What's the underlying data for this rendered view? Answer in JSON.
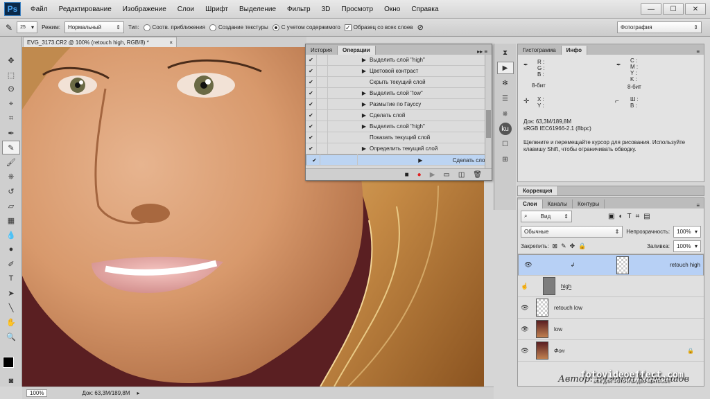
{
  "menubar": {
    "logo": "Ps",
    "items": [
      "Файл",
      "Редактирование",
      "Изображение",
      "Слои",
      "Шрифт",
      "Выделение",
      "Фильтр",
      "3D",
      "Просмотр",
      "Окно",
      "Справка"
    ],
    "win_controls": [
      "—",
      "☐",
      "✕"
    ]
  },
  "options": {
    "brush_size": "25",
    "mode_label": "Режим:",
    "mode_value": "Нормальный",
    "type_label": "Тип:",
    "opt1": "Соотв. приближения",
    "opt2": "Создание текстуры",
    "opt3": "С учетом содержимого",
    "sample_all": "Образец со всех слоев",
    "workspace": "Фотография"
  },
  "document": {
    "tab_title": "EVG_3173.CR2 @ 100% (retouch high, RGB/8) *",
    "close": "×"
  },
  "status": {
    "zoom": "100%",
    "doc_info": "Док: 63,3M/189,8M"
  },
  "actions_panel": {
    "tab_history": "История",
    "tab_actions": "Операции",
    "rows": [
      {
        "label": "Выделить слой \"high\"",
        "expand": true
      },
      {
        "label": "Цветовой контраст",
        "expand": true
      },
      {
        "label": "Скрыть текущий слой",
        "expand": false
      },
      {
        "label": "Выделить слой \"low\"",
        "expand": true
      },
      {
        "label": "Размытие по Гауссу",
        "expand": true
      },
      {
        "label": "Сделать слой",
        "expand": true
      },
      {
        "label": "Выделить слой \"high\"",
        "expand": true
      },
      {
        "label": "Показать текущий слой",
        "expand": false
      },
      {
        "label": "Определить текущий слой",
        "expand": true
      },
      {
        "label": "Сделать слой",
        "expand": true
      }
    ]
  },
  "info_panel": {
    "tab_hist": "Гистограмма",
    "tab_info": "Инфо",
    "rgb": [
      "R :",
      "G :",
      "B :"
    ],
    "cmyk": [
      "C :",
      "M :",
      "Y :",
      "K :"
    ],
    "bit1": "8-бит",
    "bit2": "8-бит",
    "xy": [
      "X :",
      "Y :"
    ],
    "wh": [
      "Ш :",
      "В :"
    ],
    "doc": "Док: 63,3M/189,8M",
    "profile": "sRGB IEC61966-2.1 (8bpc)",
    "hint": "Щелкните и перемещайте курсор для рисования. Используйте клавишу Shift, чтобы ограничивать обводку."
  },
  "correction_panel": {
    "title": "Коррекция"
  },
  "layers_panel": {
    "tab_layers": "Слои",
    "tab_channels": "Каналы",
    "tab_paths": "Контуры",
    "filter": "Вид",
    "blend": "Обычные",
    "opacity_label": "Непрозрачность:",
    "opacity": "100%",
    "lock_label": "Закрепить:",
    "fill_label": "Заливка:",
    "fill": "100%",
    "layers": [
      {
        "name": "retouch high",
        "selected": true,
        "thumb": "checker"
      },
      {
        "name": "high",
        "selected": false,
        "thumb": "gray"
      },
      {
        "name": "retouch low",
        "selected": false,
        "thumb": "checker"
      },
      {
        "name": "low",
        "selected": false,
        "thumb": "photo"
      },
      {
        "name": "Фон",
        "selected": false,
        "thumb": "photo"
      }
    ]
  },
  "watermark": {
    "site": "fotovideoeffect.com",
    "tagline": "ВСЁ ДЛЯ ФОТО И ВИДЕО МОНТАЖА!",
    "author": "Автор: Евгений Карташов"
  },
  "colors": {
    "selection": "#b7d0f5",
    "record": "#e02020",
    "panel_bg": "#e0e0e0"
  }
}
